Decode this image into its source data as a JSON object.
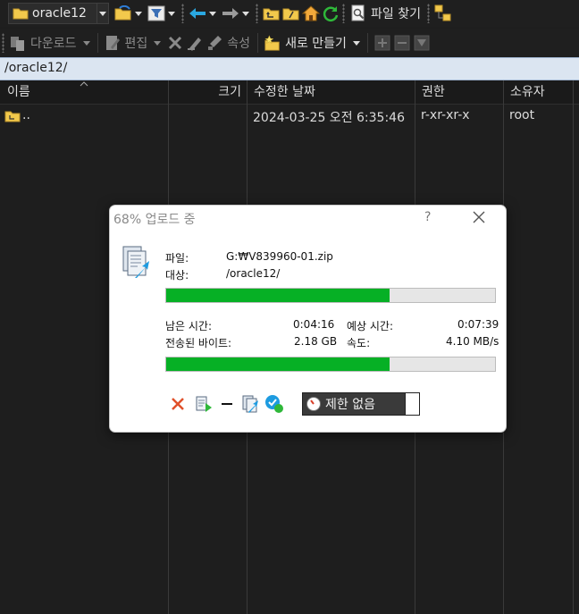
{
  "toolbar1": {
    "location": "oracle12",
    "find_files_label": "파일 찾기"
  },
  "toolbar2": {
    "download_label": "다운로드",
    "edit_label": "편집",
    "properties_label": "속성",
    "new_label": "새로 만들기"
  },
  "path": "/oracle12/",
  "columns": {
    "name": "이름",
    "size": "크기",
    "modified": "수정한 날짜",
    "rights": "권한",
    "owner": "소유자"
  },
  "rows": [
    {
      "name": "..",
      "size": "",
      "modified": "2024-03-25 오전 6:35:46",
      "rights": "r-xr-xr-x",
      "owner": "root"
    }
  ],
  "dialog": {
    "title": "68% 업로드 중",
    "help": "?",
    "file_label": "파일:",
    "file_value": "G:₩V839960-01.zip",
    "target_label": "대상:",
    "target_value": "/oracle12/",
    "file_progress_pct": 68,
    "time_left_label": "남은 시간:",
    "time_left_value": "0:04:16",
    "est_time_label": "예상 시간:",
    "est_time_value": "0:07:39",
    "bytes_label": "전송된 바이트:",
    "bytes_value": "2.18 GB",
    "speed_label": "속도:",
    "speed_value": "4.10 MB/s",
    "total_progress_pct": 68,
    "speed_limit_label": "제한 없음"
  },
  "colors": {
    "progress": "#06b025",
    "path_bar": "#dbe5f1",
    "background": "#1e1e1e"
  }
}
